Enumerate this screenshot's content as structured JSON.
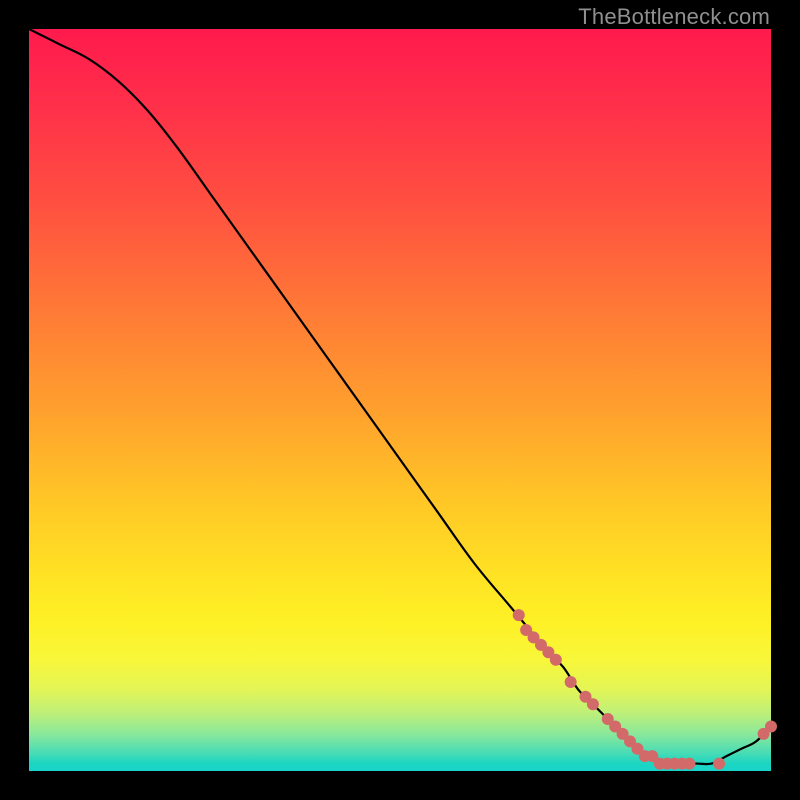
{
  "watermark": "TheBottleneck.com",
  "colors": {
    "marker": "#d36a6a",
    "curve": "#000000",
    "gradient_top": "#ff1a4d",
    "gradient_bottom": "#19d3c9",
    "background": "#000000"
  },
  "chart_data": {
    "type": "line",
    "title": "",
    "xlabel": "",
    "ylabel": "",
    "xlim": [
      0,
      100
    ],
    "ylim": [
      0,
      100
    ],
    "grid": false,
    "legend": false,
    "notes": "Axes have no tick labels; values are approximate, read from the plot geometry. Y decreases from 100 at top-left to ~0 near x≈85, then rises slightly toward x=100.",
    "series": [
      {
        "name": "bottleneck-curve",
        "x": [
          0,
          4,
          8,
          12,
          16,
          20,
          25,
          30,
          35,
          40,
          45,
          50,
          55,
          60,
          65,
          70,
          72,
          74,
          76,
          78,
          80,
          82,
          84,
          86,
          88,
          90,
          92,
          94,
          96,
          98,
          100
        ],
        "y": [
          100,
          98,
          96,
          93,
          89,
          84,
          77,
          70,
          63,
          56,
          49,
          42,
          35,
          28,
          22,
          16,
          14,
          11,
          9,
          7,
          5,
          3,
          2,
          1,
          1,
          1,
          1,
          2,
          3,
          4,
          6
        ]
      }
    ],
    "markers": {
      "name": "highlighted-points",
      "description": "Salmon dots overlaid on the curve in the lower-right region",
      "x": [
        66,
        67,
        68,
        69,
        70,
        71,
        73,
        75,
        76,
        78,
        79,
        80,
        81,
        82,
        83,
        84,
        85,
        86,
        87,
        88,
        89,
        93,
        99,
        100
      ],
      "y": [
        21,
        19,
        18,
        17,
        16,
        15,
        12,
        10,
        9,
        7,
        6,
        5,
        4,
        3,
        2,
        2,
        1,
        1,
        1,
        1,
        1,
        1,
        5,
        6
      ]
    }
  }
}
